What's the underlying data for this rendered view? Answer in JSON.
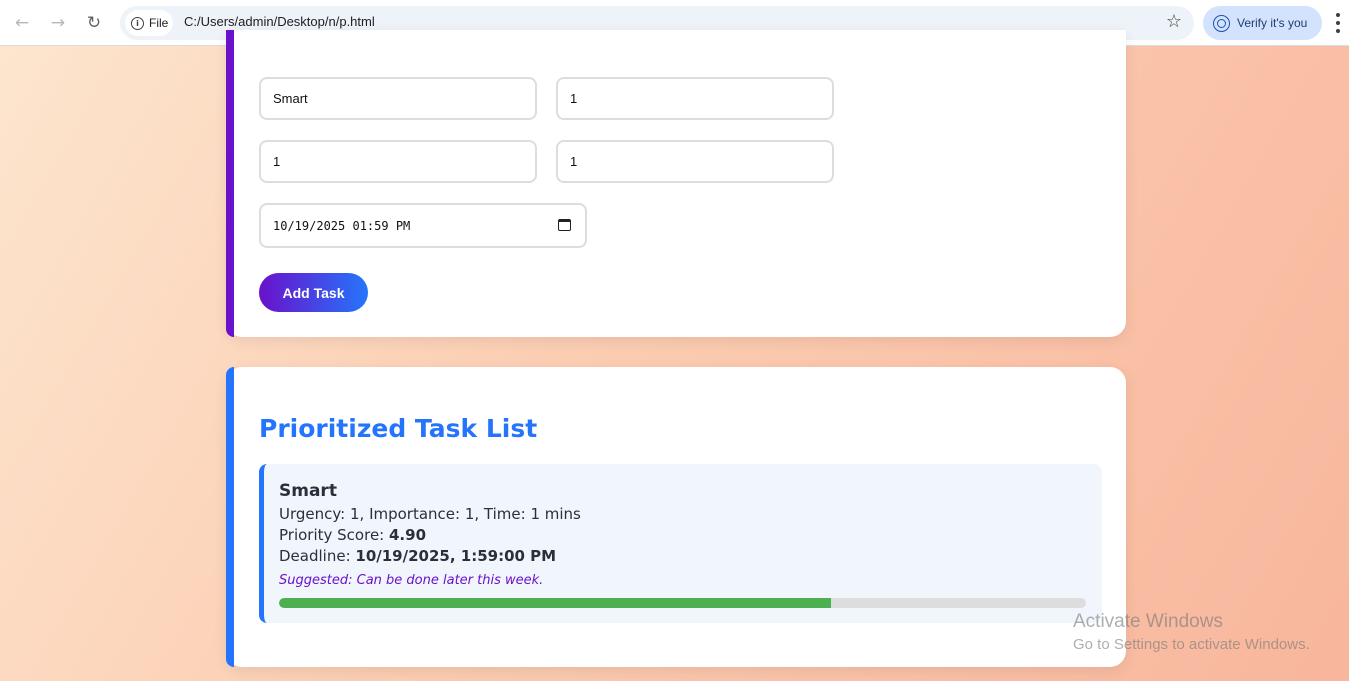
{
  "browser": {
    "file_label": "File",
    "url": "C:/Users/admin/Desktop/n/p.html",
    "verify_label": "Verify it's you",
    "icons": [
      "back-icon",
      "forward-icon",
      "reload-icon",
      "info-icon",
      "star-icon",
      "account-icon",
      "menu-icon"
    ]
  },
  "form": {
    "task_name": "Smart",
    "urgency": "1",
    "importance": "1",
    "time": "1",
    "deadline": "10/19/2025 01:59 PM",
    "add_label": "Add Task",
    "accent": "#6a11cb"
  },
  "list": {
    "title": "Prioritized Task List",
    "accent": "#2575fc",
    "tasks": [
      {
        "name": "Smart",
        "details": "Urgency: 1, Importance: 1, Time: 1 mins",
        "score_label": "Priority Score: ",
        "score": "4.90",
        "deadline_label": "Deadline: ",
        "deadline": "10/19/2025, 1:59:00 PM",
        "suggestion": "Suggested: Can be done later this week.",
        "progress_fraction": 0.684,
        "progress_color": "#4caf50"
      }
    ]
  },
  "watermark": {
    "title": "Activate Windows",
    "subtitle": "Go to Settings to activate Windows."
  }
}
